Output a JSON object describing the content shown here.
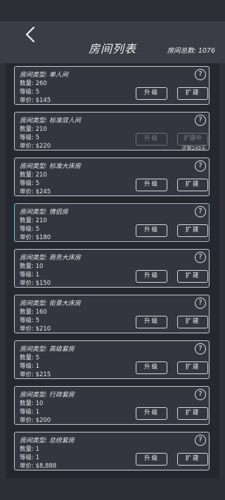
{
  "header": {
    "title": "房间列表",
    "total_label": "房间总数:",
    "total_value": "1076"
  },
  "labels": {
    "type": "房间类型: ",
    "count": "数量: ",
    "level": "等级: ",
    "price": "单价: ",
    "help": "?"
  },
  "rooms": [
    {
      "type": "单人间",
      "count": "260",
      "level": "5",
      "price": "$145",
      "upgrade": "升级",
      "expand": "扩建"
    },
    {
      "type": "标准双人间",
      "count": "210",
      "level": "5",
      "price": "$220",
      "upgrade": "升级",
      "expand": "扩建中",
      "note": "还剩249天"
    },
    {
      "type": "标准大床房",
      "count": "210",
      "level": "5",
      "price": "$245",
      "upgrade": "升级",
      "expand": "扩建"
    },
    {
      "type": "情侣房",
      "count": "210",
      "level": "5",
      "price": "$180",
      "upgrade": "升级",
      "expand": "扩建"
    },
    {
      "type": "商务大床房",
      "count": "10",
      "level": "1",
      "price": "$150",
      "upgrade": "升级",
      "expand": "扩建"
    },
    {
      "type": "街景大床房",
      "count": "160",
      "level": "5",
      "price": "$210",
      "upgrade": "升级",
      "expand": "扩建"
    },
    {
      "type": "高级套房",
      "count": "5",
      "level": "1",
      "price": "$215",
      "upgrade": "升级",
      "expand": "扩建"
    },
    {
      "type": "行政套房",
      "count": "10",
      "level": "1",
      "price": "$200",
      "upgrade": "升级",
      "expand": "扩建"
    },
    {
      "type": "总统套房",
      "count": "1",
      "level": "1",
      "price": "$8,888",
      "upgrade": "升级",
      "expand": "扩建"
    }
  ]
}
